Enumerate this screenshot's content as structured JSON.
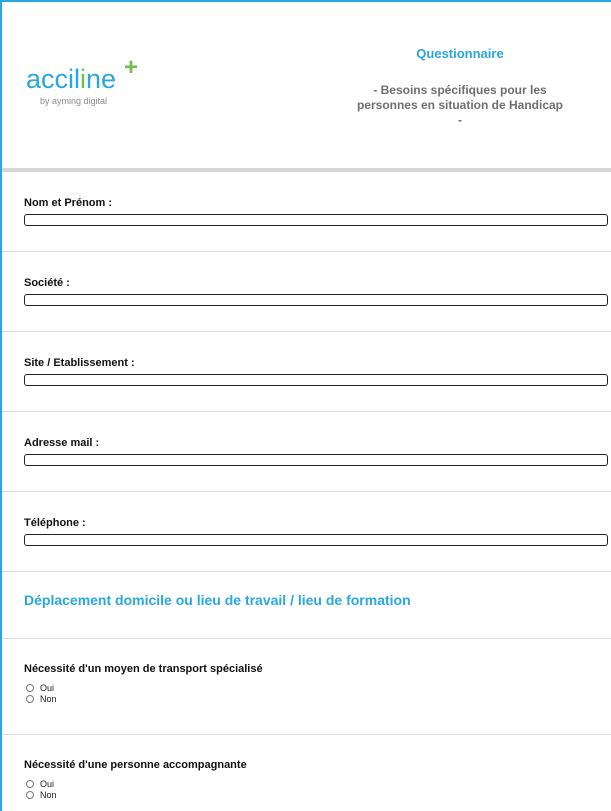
{
  "header": {
    "logo_word_prefix": "acci",
    "logo_word_i": "l",
    "logo_word_i2": "i",
    "logo_word_suffix": "ne",
    "logo_plus": "+",
    "logo_tagline": "by ayming digital",
    "title": "Questionnaire",
    "subtitle": "- Besoins spécifiques pour les personnes en situation de Handicap -"
  },
  "fields": [
    {
      "label": "Nom et Prénom :",
      "value": ""
    },
    {
      "label": "Société :",
      "value": ""
    },
    {
      "label": "Site / Etablissement :",
      "value": ""
    },
    {
      "label": "Adresse mail :",
      "value": ""
    },
    {
      "label": "Téléphone :",
      "value": ""
    }
  ],
  "section": {
    "title": "Déplacement domicile ou lieu de travail / lieu de formation"
  },
  "questions": [
    {
      "label": "Nécessité d'un moyen de transport spécialisé",
      "options": [
        "Oui",
        "Non"
      ]
    },
    {
      "label": "Nécessité d'une personne accompagnante",
      "options": [
        "Oui",
        "Non"
      ]
    }
  ],
  "colors": {
    "accent": "#29a8e0",
    "brand_green": "#6cc04a",
    "subtitle_gray": "#6f6f6f"
  }
}
